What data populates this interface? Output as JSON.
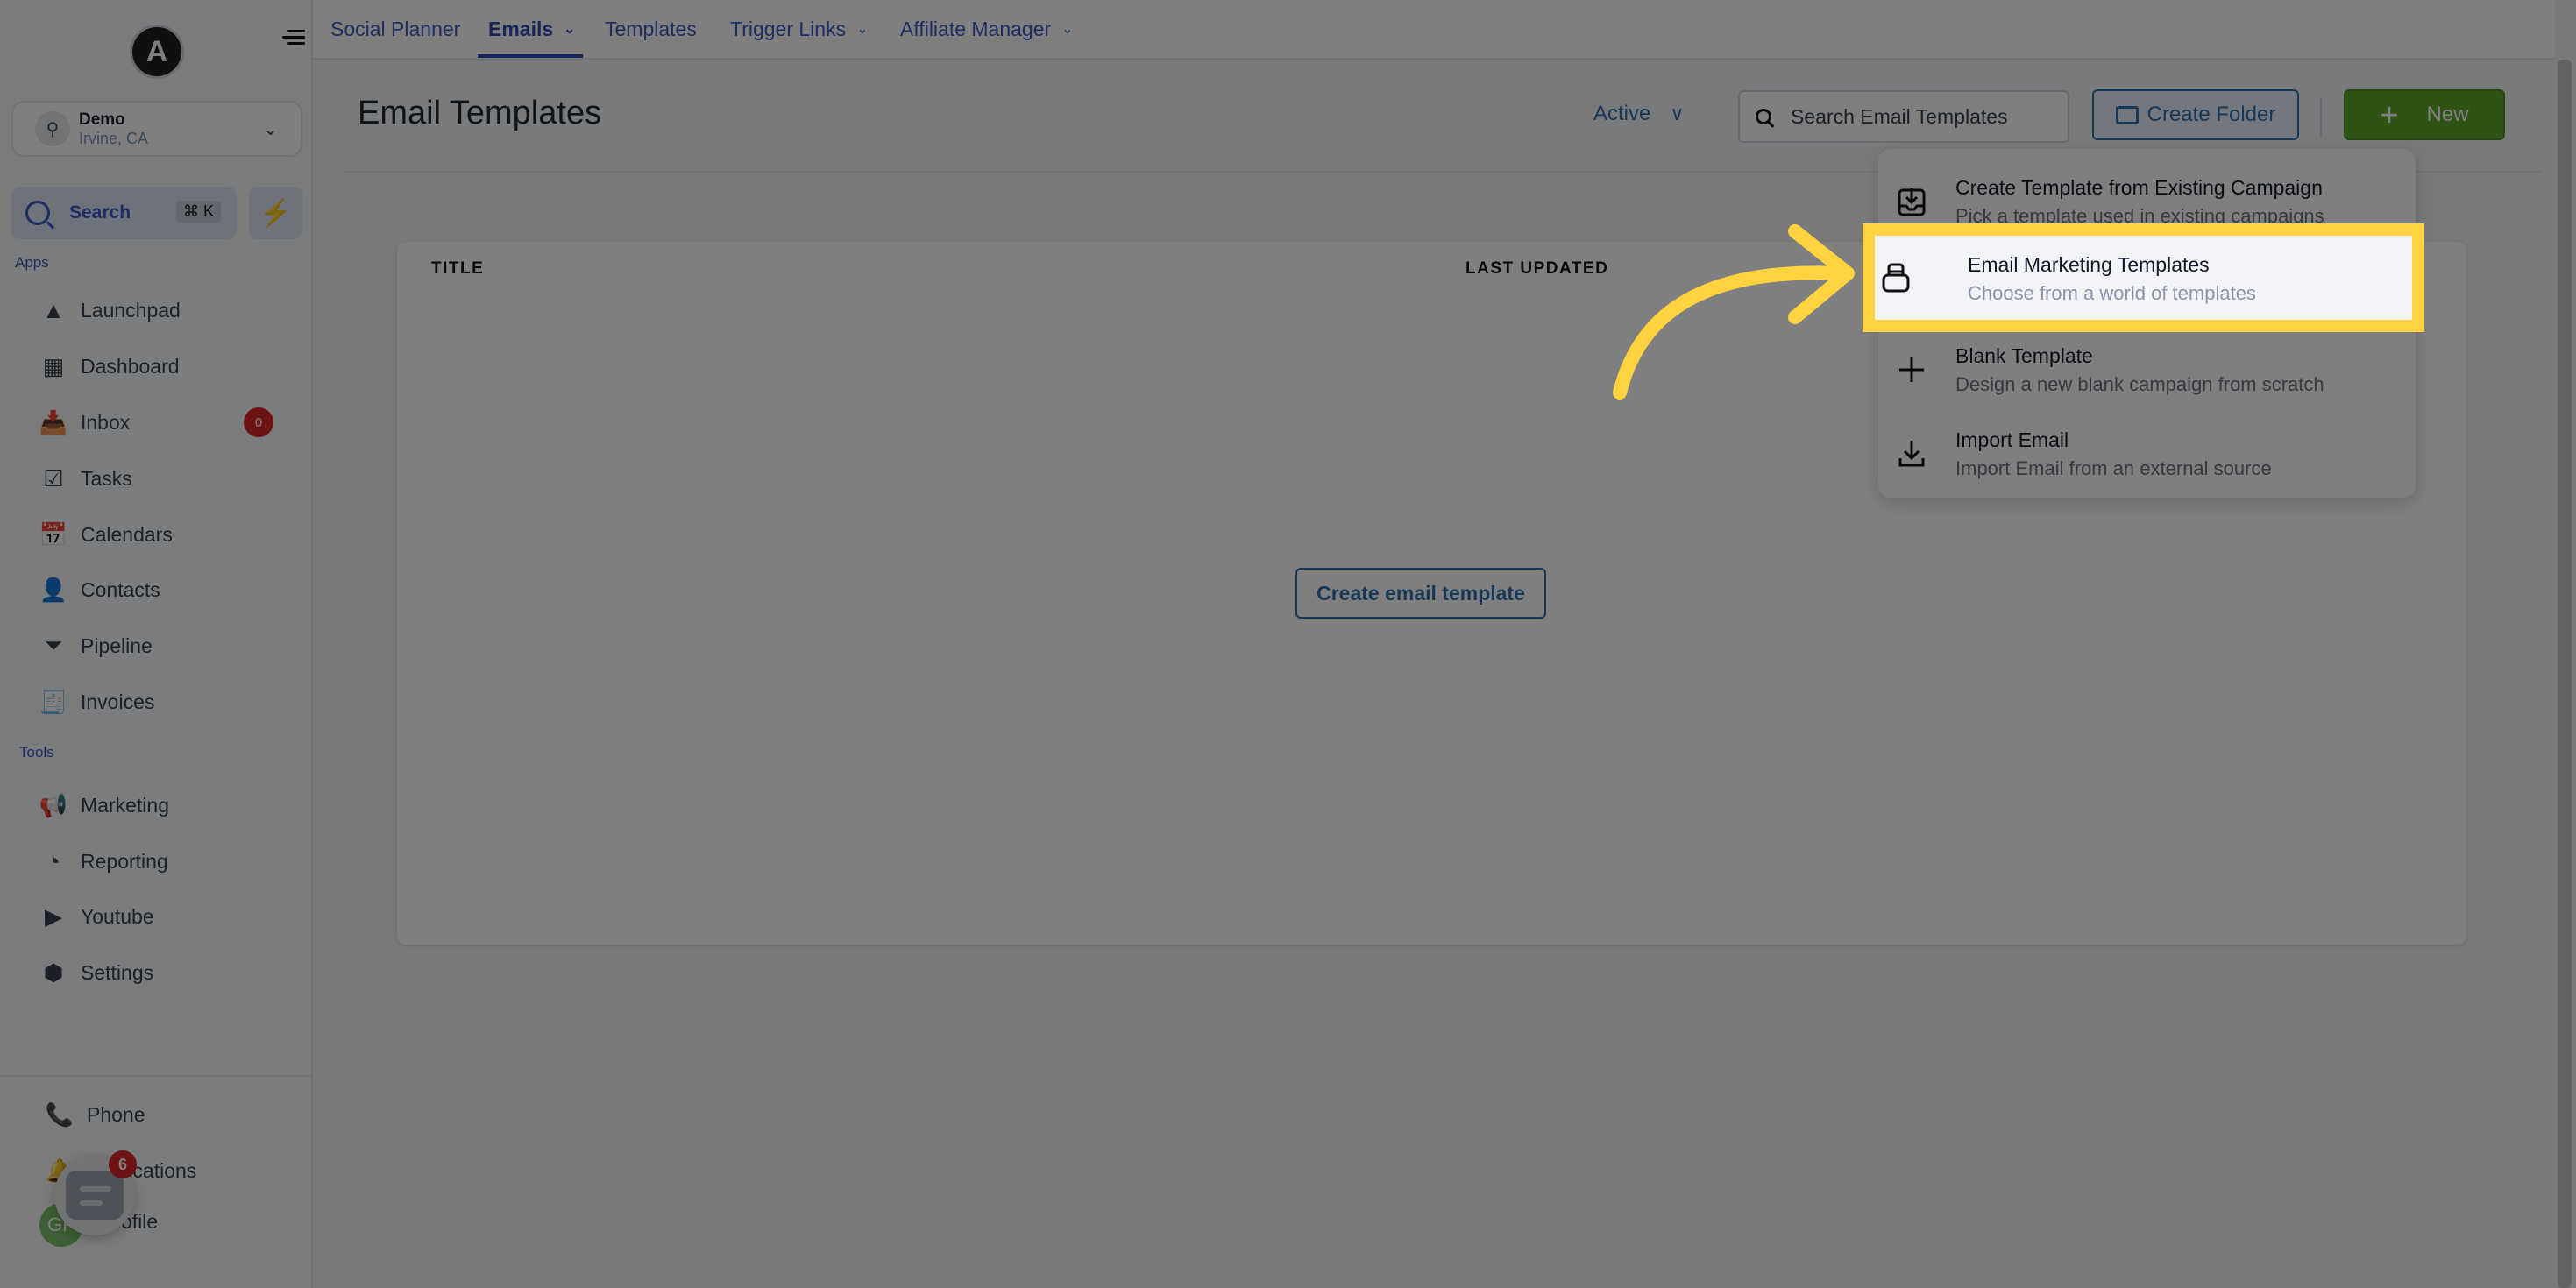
{
  "sidebar": {
    "logo_letter": "A",
    "location": {
      "name": "Demo",
      "sub": "Irvine, CA"
    },
    "search": {
      "label": "Search",
      "shortcut": "⌘ K"
    },
    "sections": {
      "apps": "Apps",
      "tools": "Tools"
    },
    "apps": [
      {
        "label": "Launchpad",
        "icon": "launchpad-icon"
      },
      {
        "label": "Dashboard",
        "icon": "dashboard-icon"
      },
      {
        "label": "Inbox",
        "icon": "inbox-icon",
        "badge": "0"
      },
      {
        "label": "Tasks",
        "icon": "tasks-icon"
      },
      {
        "label": "Calendars",
        "icon": "calendar-icon"
      },
      {
        "label": "Contacts",
        "icon": "contacts-icon"
      },
      {
        "label": "Pipeline",
        "icon": "pipeline-icon"
      },
      {
        "label": "Invoices",
        "icon": "invoices-icon"
      }
    ],
    "tools": [
      {
        "label": "Marketing",
        "icon": "megaphone-icon"
      },
      {
        "label": "Reporting",
        "icon": "pie-chart-icon"
      },
      {
        "label": "Youtube",
        "icon": "youtube-icon"
      },
      {
        "label": "Settings",
        "icon": "gear-icon"
      }
    ],
    "bottom": [
      {
        "label": "Phone",
        "icon": "phone-icon"
      },
      {
        "label": "Notifications",
        "icon": "bell-icon"
      },
      {
        "label": "Profile",
        "icon": "avatar"
      }
    ],
    "avatar_initials": "GP",
    "chat_badge": "6"
  },
  "topnav": {
    "items": [
      {
        "label": "Social Planner",
        "dropdown": false
      },
      {
        "label": "Emails",
        "dropdown": true,
        "active": true
      },
      {
        "label": "Templates",
        "dropdown": false
      },
      {
        "label": "Trigger Links",
        "dropdown": true
      },
      {
        "label": "Affiliate Manager",
        "dropdown": true
      }
    ]
  },
  "main": {
    "title": "Email Templates",
    "status_filter": "Active",
    "search_placeholder": "Search Email Templates",
    "create_folder_label": "Create Folder",
    "new_label": "New",
    "table": {
      "columns": [
        "TITLE",
        "LAST UPDATED"
      ],
      "empty_action": "Create email template"
    }
  },
  "new_menu": {
    "items": [
      {
        "title": "Create Template from Existing Campaign",
        "desc": "Pick a template used in existing campaigns",
        "icon": "inbox-download-icon"
      },
      {
        "title": "Email Marketing Templates",
        "desc": "Choose from a world of templates",
        "icon": "template-stack-icon",
        "highlighted": true
      },
      {
        "title": "Blank Template",
        "desc": "Design a new blank campaign from scratch",
        "icon": "plus-icon"
      },
      {
        "title": "Import Email",
        "desc": "Import Email from an external source",
        "icon": "download-icon"
      }
    ]
  },
  "colors": {
    "accent_blue": "#3b5bc5",
    "primary_green": "#5ea52b",
    "highlight_yellow": "#ffd23f",
    "badge_red": "#dc2626"
  }
}
